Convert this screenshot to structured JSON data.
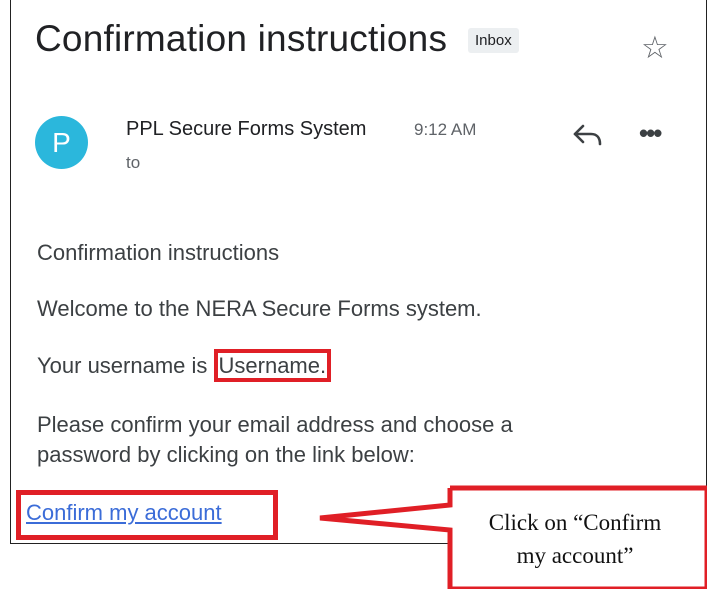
{
  "email": {
    "subject": "Confirmation instructions",
    "label": "Inbox",
    "sender_initial": "P",
    "sender_name": "PPL Secure Forms System",
    "time": "9:12 AM",
    "to": "to",
    "body": {
      "line1": "Confirmation instructions",
      "line2": "Welcome to the NERA Secure Forms system.",
      "line3_prefix": "Your username is ",
      "username": "Username.",
      "line4a": "Please confirm your email address and choose a",
      "line4b": "password by clicking on the link below:",
      "link_text": "Confirm my account"
    }
  },
  "callout": {
    "line1": "Click on “Confirm",
    "line2": "my account”"
  },
  "colors": {
    "highlight": "#e01f26",
    "link": "#3b6cd8",
    "avatar": "#2bb7dc"
  },
  "icons": {
    "star": "star-icon",
    "reply": "reply-icon",
    "more": "more-icon"
  }
}
